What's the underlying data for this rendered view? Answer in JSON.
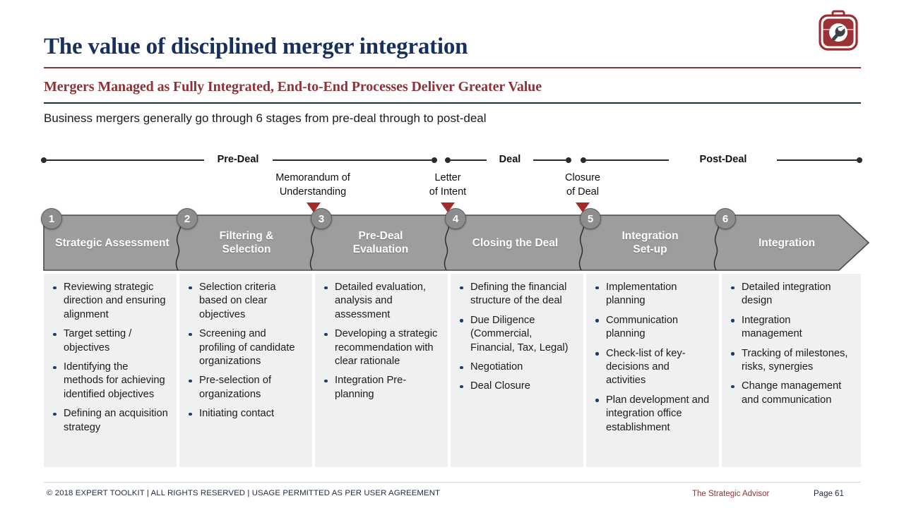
{
  "header": {
    "title": "The value of disciplined merger integration",
    "subtitle": "Mergers Managed as Fully Integrated, End-to-End Processes Deliver Greater Value",
    "lead": "Business mergers generally go through 6 stages from pre-deal through to post-deal",
    "logo_icon": "toolbox-wrench-icon",
    "accent_red": "#8e3336",
    "accent_navy": "#18305e"
  },
  "timeline": {
    "phases": [
      {
        "label": "Pre-Deal"
      },
      {
        "label": "Deal"
      },
      {
        "label": "Post-Deal"
      }
    ],
    "milestones": [
      {
        "line1": "Memorandum of",
        "line2": "Understanding"
      },
      {
        "line1": "Letter",
        "line2": "of Intent"
      },
      {
        "line1": "Closure",
        "line2": "of Deal"
      }
    ]
  },
  "stages": [
    {
      "number": "1",
      "title_line1": "Strategic Assessment",
      "title_line2": "",
      "bullets": [
        "Reviewing strategic direction and ensuring alignment",
        "Target setting / objectives",
        "Identifying the methods for achieving identified objectives",
        "Defining an acquisition strategy"
      ]
    },
    {
      "number": "2",
      "title_line1": "Filtering &",
      "title_line2": "Selection",
      "bullets": [
        "Selection criteria based on clear objectives",
        "Screening and profiling of candidate organizations",
        "Pre-selection of organizations",
        "Initiating contact"
      ]
    },
    {
      "number": "3",
      "title_line1": "Pre-Deal",
      "title_line2": "Evaluation",
      "bullets": [
        "Detailed evaluation, analysis and assessment",
        "Developing a strategic recommendation with clear rationale",
        "Integration Pre-planning"
      ]
    },
    {
      "number": "4",
      "title_line1": "Closing the Deal",
      "title_line2": "",
      "bullets": [
        "Defining the financial structure of the deal",
        "Due Diligence (Commercial, Financial, Tax, Legal)",
        "Negotiation",
        "Deal Closure"
      ]
    },
    {
      "number": "5",
      "title_line1": "Integration",
      "title_line2": "Set-up",
      "bullets": [
        "Implementation planning",
        "Communication planning",
        "Check-list of key-decisions and activities",
        "Plan development and integration office establishment"
      ]
    },
    {
      "number": "6",
      "title_line1": "Integration",
      "title_line2": "",
      "bullets": [
        "Detailed integration design",
        "Integration management",
        "Tracking of milestones, risks, synergies",
        "Change management and communication"
      ]
    }
  ],
  "footer": {
    "copyright": "© 2018 EXPERT TOOLKIT | ALL RIGHTS RESERVED | USAGE PERMITTED AS PER USER AGREEMENT",
    "brand": "The Strategic Advisor",
    "page": "Page 61"
  }
}
